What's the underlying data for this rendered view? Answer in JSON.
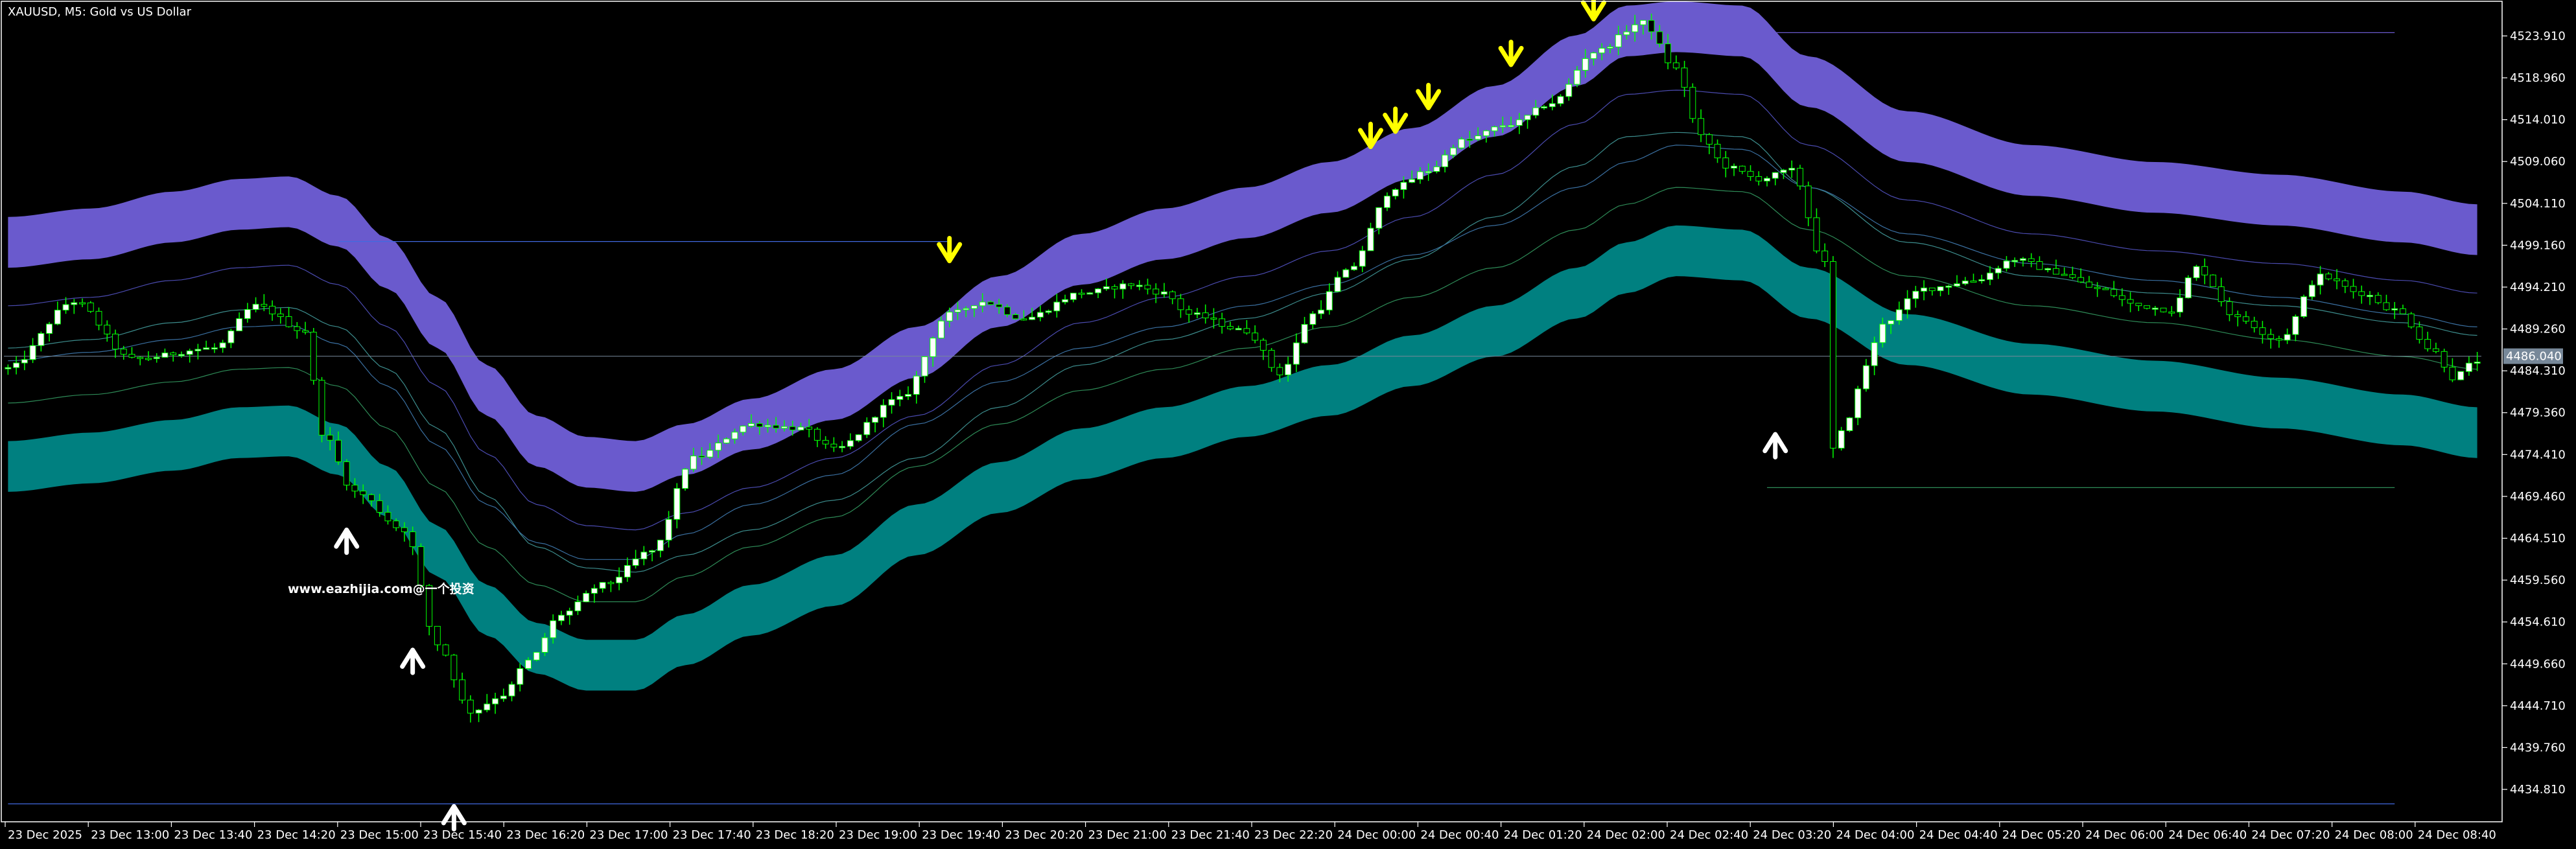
{
  "window": {
    "symbol_title": "XAUUSD, M5:  Gold vs US Dollar",
    "watermark": "www.eazhijia.com@一个投资"
  },
  "colors": {
    "background": "#000000",
    "upper_band": "#6a5acd",
    "lower_band": "#008080",
    "candle_bull": "#ffffff",
    "candle_bear": "#000000",
    "wick": "#00ff00",
    "signal_sell": "#ffff00",
    "signal_buy": "#ffffff",
    "price_label_bg": "#778899",
    "axis_text": "#ffffff"
  },
  "chart_data": {
    "type": "candlestick",
    "ylim": [
      4431.9,
      4527.7
    ],
    "y_ticks": [
      "4523.910",
      "4518.960",
      "4514.010",
      "4509.060",
      "4504.110",
      "4499.160",
      "4494.210",
      "4489.260",
      "4484.310",
      "4479.360",
      "4474.410",
      "4469.460",
      "4464.510",
      "4459.560",
      "4454.610",
      "4449.660",
      "4444.710",
      "4439.760",
      "4434.810"
    ],
    "x_ticks": [
      "23 Dec 2025",
      "23 Dec 13:00",
      "23 Dec 13:40",
      "23 Dec 14:20",
      "23 Dec 15:00",
      "23 Dec 15:40",
      "23 Dec 16:20",
      "23 Dec 17:00",
      "23 Dec 17:40",
      "23 Dec 18:20",
      "23 Dec 19:00",
      "23 Dec 19:40",
      "23 Dec 20:20",
      "23 Dec 21:00",
      "23 Dec 21:40",
      "23 Dec 22:20",
      "24 Dec 00:00",
      "24 Dec 00:40",
      "24 Dec 01:20",
      "24 Dec 02:00",
      "24 Dec 02:40",
      "24 Dec 03:20",
      "24 Dec 04:00",
      "24 Dec 04:40",
      "24 Dec 05:20",
      "24 Dec 06:00",
      "24 Dec 06:40",
      "24 Dec 07:20",
      "24 Dec 08:00",
      "24 Dec 08:40"
    ],
    "current_price": "4486.040",
    "bar_count": 300,
    "close_anchors": [
      [
        0,
        4484.6
      ],
      [
        8,
        4492.5
      ],
      [
        15,
        4485.7
      ],
      [
        25,
        4487.0
      ],
      [
        30,
        4492.0
      ],
      [
        36,
        4489.0
      ],
      [
        38,
        4477.0
      ],
      [
        42,
        4470.0
      ],
      [
        48,
        4465.5
      ],
      [
        52,
        4452.0
      ],
      [
        56,
        4444.0
      ],
      [
        60,
        4446.0
      ],
      [
        63,
        4450.0
      ],
      [
        67,
        4455.5
      ],
      [
        72,
        4459.0
      ],
      [
        78,
        4463.0
      ],
      [
        83,
        4474.0
      ],
      [
        90,
        4478.0
      ],
      [
        96,
        4477.5
      ],
      [
        100,
        4475.0
      ],
      [
        108,
        4481.0
      ],
      [
        114,
        4491.0
      ],
      [
        118,
        4492.5
      ],
      [
        123,
        4490.5
      ],
      [
        130,
        4493.5
      ],
      [
        136,
        4494.5
      ],
      [
        140,
        4493.5
      ],
      [
        143,
        4491.0
      ],
      [
        150,
        4489.0
      ],
      [
        154,
        4484.0
      ],
      [
        158,
        4491.0
      ],
      [
        162,
        4496.0
      ],
      [
        168,
        4506.0
      ],
      [
        172,
        4508.0
      ],
      [
        176,
        4511.5
      ],
      [
        182,
        4513.5
      ],
      [
        187,
        4516.0
      ],
      [
        192,
        4522.0
      ],
      [
        198,
        4525.5
      ],
      [
        202,
        4520.0
      ],
      [
        205,
        4512.0
      ],
      [
        208,
        4508.5
      ],
      [
        212,
        4507.0
      ],
      [
        216,
        4508.0
      ],
      [
        220,
        4497.0
      ],
      [
        221,
        4475.0
      ],
      [
        223,
        4479.0
      ],
      [
        225,
        4485.0
      ],
      [
        227,
        4490.0
      ],
      [
        232,
        4494.0
      ],
      [
        238,
        4495.0
      ],
      [
        243,
        4497.5
      ],
      [
        248,
        4496.0
      ],
      [
        253,
        4494.0
      ],
      [
        258,
        4492.0
      ],
      [
        262,
        4491.5
      ],
      [
        265,
        4496.5
      ],
      [
        270,
        4490.5
      ],
      [
        275,
        4488.0
      ],
      [
        280,
        4495.5
      ],
      [
        285,
        4493.5
      ],
      [
        289,
        4491.5
      ],
      [
        294,
        4486.5
      ],
      [
        296,
        4483.5
      ],
      [
        299,
        4485.5
      ]
    ],
    "upper_band_anchors": [
      [
        0,
        4499.5
      ],
      [
        10,
        4500.5
      ],
      [
        20,
        4502.5
      ],
      [
        28,
        4504.0
      ],
      [
        34,
        4504.3
      ],
      [
        40,
        4502.0
      ],
      [
        46,
        4497.0
      ],
      [
        52,
        4490.0
      ],
      [
        58,
        4482.0
      ],
      [
        64,
        4476.0
      ],
      [
        70,
        4473.5
      ],
      [
        76,
        4473.0
      ],
      [
        82,
        4475.0
      ],
      [
        90,
        4478.0
      ],
      [
        100,
        4481.5
      ],
      [
        110,
        4486.5
      ],
      [
        120,
        4492.5
      ],
      [
        130,
        4497.5
      ],
      [
        140,
        4500.5
      ],
      [
        150,
        4503.0
      ],
      [
        160,
        4506.0
      ],
      [
        170,
        4510.0
      ],
      [
        180,
        4515.0
      ],
      [
        190,
        4521.0
      ],
      [
        196,
        4524.5
      ],
      [
        202,
        4525.0
      ],
      [
        210,
        4524.5
      ],
      [
        218,
        4518.5
      ],
      [
        230,
        4512.0
      ],
      [
        245,
        4508.0
      ],
      [
        260,
        4506.0
      ],
      [
        275,
        4504.5
      ],
      [
        290,
        4502.5
      ],
      [
        299,
        4501.0
      ]
    ],
    "lower_band_anchors": [
      [
        0,
        4473.0
      ],
      [
        10,
        4474.0
      ],
      [
        20,
        4475.5
      ],
      [
        28,
        4477.0
      ],
      [
        34,
        4477.2
      ],
      [
        40,
        4475.0
      ],
      [
        46,
        4470.0
      ],
      [
        52,
        4463.0
      ],
      [
        58,
        4456.0
      ],
      [
        64,
        4451.5
      ],
      [
        70,
        4449.5
      ],
      [
        76,
        4449.5
      ],
      [
        82,
        4452.5
      ],
      [
        90,
        4456.0
      ],
      [
        100,
        4459.5
      ],
      [
        110,
        4465.5
      ],
      [
        120,
        4470.5
      ],
      [
        130,
        4474.5
      ],
      [
        140,
        4477.0
      ],
      [
        150,
        4479.5
      ],
      [
        160,
        4482.0
      ],
      [
        170,
        4485.5
      ],
      [
        180,
        4489.0
      ],
      [
        190,
        4493.5
      ],
      [
        196,
        4496.5
      ],
      [
        202,
        4498.5
      ],
      [
        210,
        4498.0
      ],
      [
        218,
        4493.5
      ],
      [
        230,
        4488.0
      ],
      [
        245,
        4484.5
      ],
      [
        260,
        4482.5
      ],
      [
        275,
        4480.5
      ],
      [
        290,
        4478.5
      ],
      [
        299,
        4477.0
      ]
    ],
    "band_half_width": 3.0,
    "hlines": [
      {
        "price": 4499.6,
        "from_bar": 40,
        "to_bar": 114
      },
      {
        "price": 4524.3,
        "from_bar": 210,
        "to_bar": 289
      },
      {
        "price": 4470.5,
        "from_bar": 213,
        "to_bar": 289
      },
      {
        "price": 4433.1,
        "from_bar": 0,
        "to_bar": 289
      }
    ],
    "sell_signals": [
      {
        "bar": 114,
        "price": 4497.3
      },
      {
        "bar": 165,
        "price": 4510.8
      },
      {
        "bar": 168,
        "price": 4512.6
      },
      {
        "bar": 172,
        "price": 4515.4
      },
      {
        "bar": 182,
        "price": 4520.5
      },
      {
        "bar": 192,
        "price": 4525.9
      }
    ],
    "buy_signals": [
      {
        "bar": 41,
        "price": 4465.5
      },
      {
        "bar": 49,
        "price": 4451.3
      },
      {
        "bar": 54,
        "price": 4432.8
      },
      {
        "bar": 214,
        "price": 4476.8
      }
    ]
  }
}
